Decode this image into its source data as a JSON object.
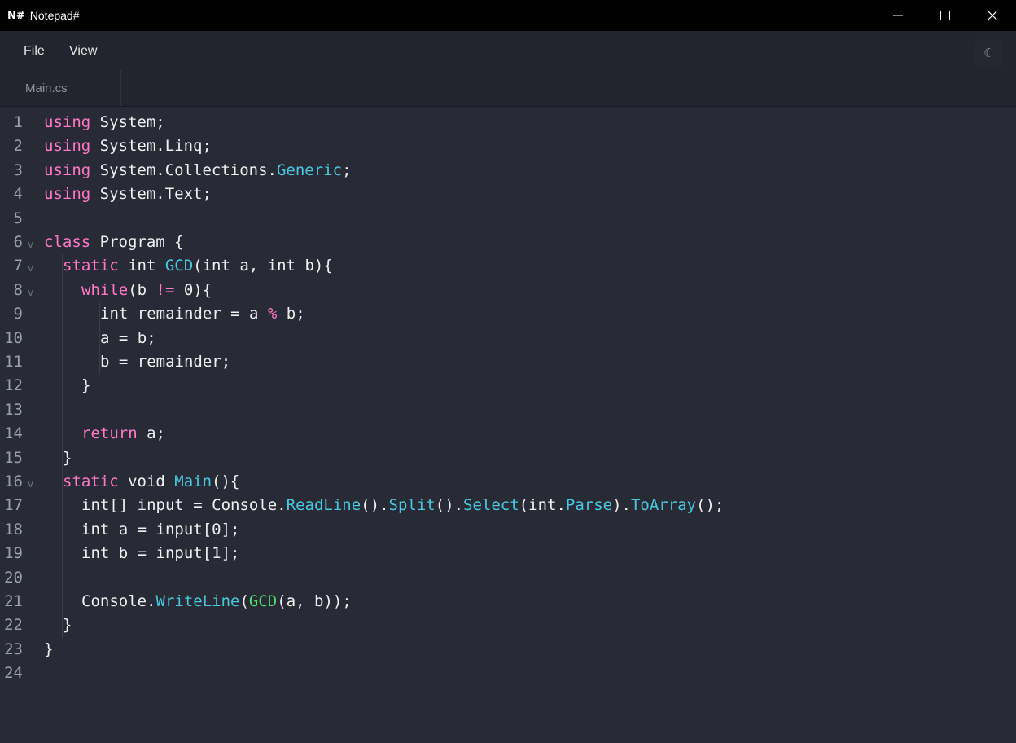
{
  "window": {
    "logo": "N#",
    "title": "Notepad#",
    "controls": {
      "minimize": "—",
      "maximize": "☐",
      "close": "✕"
    }
  },
  "menu": {
    "file": "File",
    "view": "View",
    "theme_icon": "moon-icon"
  },
  "tabs": [
    {
      "label": "Main.cs",
      "active": true
    }
  ],
  "colors": {
    "keyword": "#ff79c6",
    "method": "#48c9e0",
    "gcd_call": "#50e070",
    "text": "#f0f0f0",
    "background": "#282a36"
  },
  "editor": {
    "lines": [
      {
        "num": "1",
        "fold": false,
        "indent": 0,
        "segs": [
          [
            "kw",
            "using"
          ],
          [
            "t",
            " System;"
          ]
        ]
      },
      {
        "num": "2",
        "fold": false,
        "indent": 0,
        "segs": [
          [
            "kw",
            "using"
          ],
          [
            "t",
            " System.Linq;"
          ]
        ]
      },
      {
        "num": "3",
        "fold": false,
        "indent": 0,
        "segs": [
          [
            "kw",
            "using"
          ],
          [
            "t",
            " System.Collections."
          ],
          [
            "fn",
            "Generic"
          ],
          [
            "t",
            ";"
          ]
        ]
      },
      {
        "num": "4",
        "fold": false,
        "indent": 0,
        "segs": [
          [
            "kw",
            "using"
          ],
          [
            "t",
            " System.Text;"
          ]
        ]
      },
      {
        "num": "5",
        "fold": false,
        "indent": 0,
        "segs": []
      },
      {
        "num": "6",
        "fold": true,
        "indent": 0,
        "segs": [
          [
            "kw",
            "class"
          ],
          [
            "t",
            " Program {"
          ]
        ]
      },
      {
        "num": "7",
        "fold": true,
        "indent": 1,
        "segs": [
          [
            "kw",
            "static"
          ],
          [
            "t",
            " int "
          ],
          [
            "fn",
            "GCD"
          ],
          [
            "t",
            "(int a, int b){"
          ]
        ]
      },
      {
        "num": "8",
        "fold": true,
        "indent": 2,
        "segs": [
          [
            "kw",
            "while"
          ],
          [
            "t",
            "(b "
          ],
          [
            "kw",
            "!="
          ],
          [
            "t",
            " 0){"
          ]
        ]
      },
      {
        "num": "9",
        "fold": false,
        "indent": 3,
        "segs": [
          [
            "t",
            "int remainder = a "
          ],
          [
            "kw",
            "%"
          ],
          [
            "t",
            " b;"
          ]
        ]
      },
      {
        "num": "10",
        "fold": false,
        "indent": 3,
        "segs": [
          [
            "t",
            "a = b;"
          ]
        ]
      },
      {
        "num": "11",
        "fold": false,
        "indent": 3,
        "segs": [
          [
            "t",
            "b = remainder;"
          ]
        ]
      },
      {
        "num": "12",
        "fold": false,
        "indent": 2,
        "segs": [
          [
            "t",
            "}"
          ]
        ]
      },
      {
        "num": "13",
        "fold": false,
        "indent": 0,
        "segs": []
      },
      {
        "num": "14",
        "fold": false,
        "indent": 2,
        "segs": [
          [
            "kw",
            "return"
          ],
          [
            "t",
            " a;"
          ]
        ]
      },
      {
        "num": "15",
        "fold": false,
        "indent": 1,
        "segs": [
          [
            "t",
            "}"
          ]
        ]
      },
      {
        "num": "16",
        "fold": true,
        "indent": 1,
        "segs": [
          [
            "kw",
            "static"
          ],
          [
            "t",
            " void "
          ],
          [
            "fn",
            "Main"
          ],
          [
            "t",
            "(){"
          ]
        ]
      },
      {
        "num": "17",
        "fold": false,
        "indent": 2,
        "segs": [
          [
            "t",
            "int[] input = Console."
          ],
          [
            "fn",
            "ReadLine"
          ],
          [
            "t",
            "()."
          ],
          [
            "fn",
            "Split"
          ],
          [
            "t",
            "()."
          ],
          [
            "fn",
            "Select"
          ],
          [
            "t",
            "(int."
          ],
          [
            "fn",
            "Parse"
          ],
          [
            "t",
            ")."
          ],
          [
            "fn",
            "ToArray"
          ],
          [
            "t",
            "();"
          ]
        ]
      },
      {
        "num": "18",
        "fold": false,
        "indent": 2,
        "segs": [
          [
            "t",
            "int a = input[0];"
          ]
        ]
      },
      {
        "num": "19",
        "fold": false,
        "indent": 2,
        "segs": [
          [
            "t",
            "int b = input[1];"
          ]
        ]
      },
      {
        "num": "20",
        "fold": false,
        "indent": 0,
        "segs": []
      },
      {
        "num": "21",
        "fold": false,
        "indent": 2,
        "segs": [
          [
            "t",
            "Console."
          ],
          [
            "fn",
            "WriteLine"
          ],
          [
            "t",
            "("
          ],
          [
            "gcd",
            "GCD"
          ],
          [
            "t",
            "(a, b));"
          ]
        ]
      },
      {
        "num": "22",
        "fold": false,
        "indent": 1,
        "segs": [
          [
            "t",
            "}"
          ]
        ]
      },
      {
        "num": "23",
        "fold": false,
        "indent": 0,
        "segs": [
          [
            "t",
            "}"
          ]
        ]
      },
      {
        "num": "24",
        "fold": false,
        "indent": 0,
        "segs": []
      }
    ]
  }
}
